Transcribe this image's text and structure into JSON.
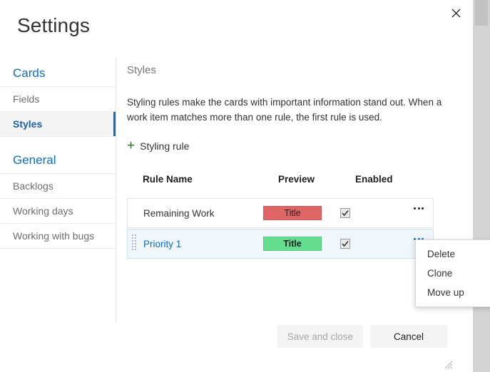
{
  "window": {
    "title": "Settings",
    "close_icon": "close-icon"
  },
  "sidebar": {
    "groups": [
      {
        "title": "Cards",
        "items": [
          {
            "label": "Fields",
            "selected": false
          },
          {
            "label": "Styles",
            "selected": true
          }
        ]
      },
      {
        "title": "General",
        "items": [
          {
            "label": "Backlogs",
            "selected": false
          },
          {
            "label": "Working days",
            "selected": false
          },
          {
            "label": "Working with bugs",
            "selected": false
          }
        ]
      }
    ]
  },
  "main": {
    "section_label": "Styles",
    "description": "Styling rules make the cards with important information stand out. When a work item matches more than one rule, the first rule is used.",
    "add_rule": {
      "icon": "plus-icon",
      "label": "Styling rule"
    },
    "table": {
      "headers": {
        "rule_name": "Rule Name",
        "preview": "Preview",
        "enabled": "Enabled"
      },
      "rows": [
        {
          "name": "Remaining Work",
          "preview_text": "Title",
          "preview_color": "#e06666",
          "enabled": true,
          "selected": false
        },
        {
          "name": "Priority 1",
          "preview_text": "Title",
          "preview_color": "#64dd8f",
          "enabled": true,
          "selected": true
        }
      ]
    }
  },
  "context_menu": {
    "items": [
      {
        "label": "Delete"
      },
      {
        "label": "Clone"
      },
      {
        "label": "Move up"
      }
    ]
  },
  "footer": {
    "save_label": "Save and close",
    "cancel_label": "Cancel",
    "save_disabled": true
  },
  "colors": {
    "accent": "#0f6cbd",
    "plus_green": "#107c10",
    "selected_row_bg": "#eff6fc",
    "preview_red": "#e06666",
    "preview_green": "#64dd8f"
  }
}
